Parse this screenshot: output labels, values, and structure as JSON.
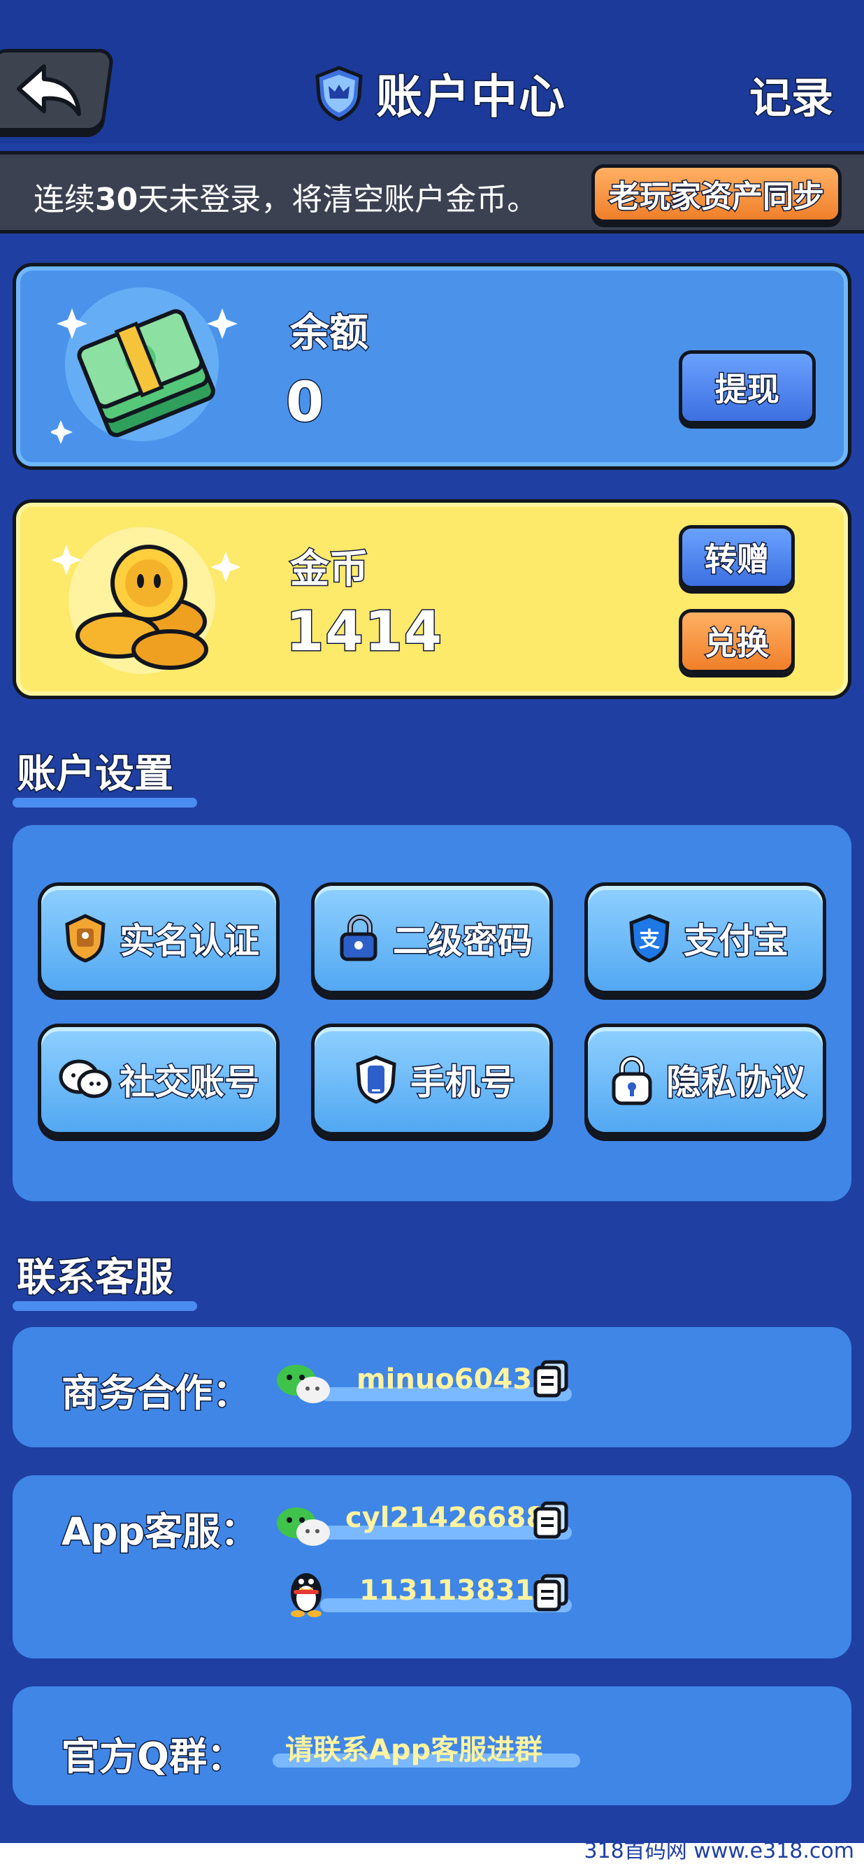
{
  "header": {
    "title": "账户中心",
    "record_label": "记录"
  },
  "notice": {
    "text_prefix": "连续",
    "text_days": "30",
    "text_suffix": "天未登录，将清空账户金币。",
    "sync_button": "老玩家资产同步"
  },
  "balance": {
    "label": "余额",
    "value": "0",
    "withdraw_button": "提现"
  },
  "coins": {
    "label": "金币",
    "value": "1414",
    "transfer_button": "转赠",
    "exchange_button": "兑换"
  },
  "account_settings": {
    "title": "账户设置",
    "items": [
      {
        "label": "实名认证",
        "icon": "id-badge-icon"
      },
      {
        "label": "二级密码",
        "icon": "padlock-icon"
      },
      {
        "label": "支付宝",
        "icon": "alipay-icon"
      },
      {
        "label": "社交账号",
        "icon": "chat-bubbles-icon"
      },
      {
        "label": "手机号",
        "icon": "phone-icon"
      },
      {
        "label": "隐私协议",
        "icon": "privacy-lock-icon"
      }
    ]
  },
  "support": {
    "title": "联系客服",
    "business": {
      "label": "商务合作：",
      "wechat": "minuo6043"
    },
    "app": {
      "label": "App客服：",
      "wechat": "cyl21426688",
      "qq": "1131138312"
    },
    "group": {
      "label": "官方Q群：",
      "value": "请联系App客服进群"
    }
  },
  "watermark": "318首码网  www.e318.com",
  "colors": {
    "background": "#1f3fa3",
    "balance_card": "#4b93ea",
    "coin_card": "#fde96a",
    "accent_orange": "#f07f2a",
    "accent_blue": "#3c6fe0"
  }
}
